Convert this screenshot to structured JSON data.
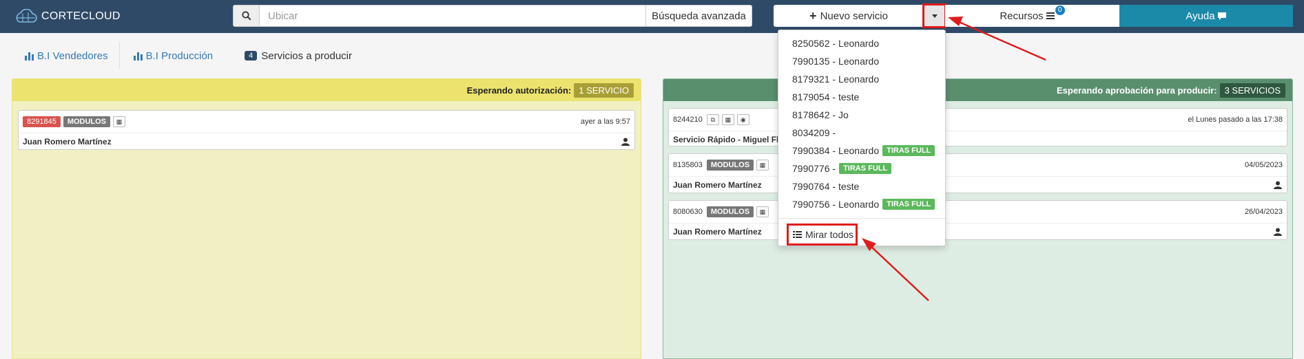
{
  "brand": {
    "name": "CORTECLOUD"
  },
  "search": {
    "placeholder": "Ubicar",
    "value": "",
    "advanced_label": "Búsqueda avanzada"
  },
  "nav": {
    "new_service_label": "Nuevo servicio",
    "resources_label": "Recursos",
    "resources_count": "0",
    "help_label": "Ayuda"
  },
  "tabs": [
    {
      "label": "B.I Vendedores"
    },
    {
      "label": "B.I Producción"
    },
    {
      "count": "4",
      "label": "Servicios a producir"
    }
  ],
  "dropdown": {
    "items": [
      {
        "text": "8250562 - Leonardo",
        "tag": ""
      },
      {
        "text": "7990135 - Leonardo",
        "tag": ""
      },
      {
        "text": "8179321 - Leonardo",
        "tag": ""
      },
      {
        "text": "8179054 - teste",
        "tag": ""
      },
      {
        "text": "8178642 - Jo",
        "tag": ""
      },
      {
        "text": "8034209 -",
        "tag": ""
      },
      {
        "text": "7990384 - Leonardo",
        "tag": "TIRAS FULL"
      },
      {
        "text": "7990776 -",
        "tag": "TIRAS FULL"
      },
      {
        "text": "7990764 - teste",
        "tag": ""
      },
      {
        "text": "7990756 - Leonardo",
        "tag": "TIRAS FULL"
      }
    ],
    "see_all_label": "Mirar todos"
  },
  "panels": {
    "waiting_auth": {
      "title": "Esperando autorización:",
      "badge": "1 SERVICIO",
      "cards": [
        {
          "id": "8291845",
          "module": "MODULOS",
          "time": "ayer a las 9:57",
          "customer": "Juan Romero Martínez"
        }
      ]
    },
    "waiting_approval": {
      "title": "Esperando aprobación para producir:",
      "badge": "3 SERVICIOS",
      "cards": [
        {
          "id": "8244210",
          "module": "",
          "time": "el Lunes pasado a las 17:38",
          "customer": "Servicio Rápido - Miguel Fl"
        },
        {
          "id": "8135803",
          "module": "MODULOS",
          "time": "04/05/2023",
          "customer": "Juan Romero Martínez"
        },
        {
          "id": "8080630",
          "module": "MODULOS",
          "time": "26/04/2023",
          "customer": "Juan Romero Martínez"
        }
      ]
    }
  },
  "colors": {
    "navbar": "#2e4a67",
    "help": "#1b8aa8",
    "highlight": "#e01b1b",
    "tag_green": "#5cb85c",
    "id_red": "#d9534f"
  }
}
